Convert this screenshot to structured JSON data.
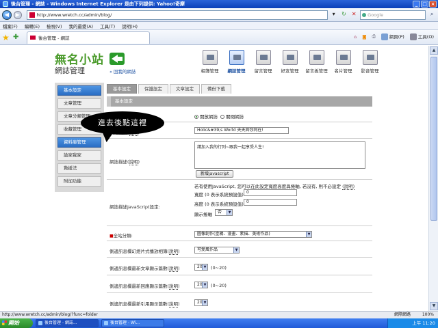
{
  "window": {
    "title": "後台管理 - 網誌 - Windows Internet Explorer 是由下列提供: Yahoo!奇摩"
  },
  "address": {
    "url": "http://www.wretch.cc/admin/blog/",
    "search_placeholder": "Google"
  },
  "menu": [
    "檔案(F)",
    "編輯(E)",
    "檢視(V)",
    "我的最愛(A)",
    "工具(T)",
    "說明(H)"
  ],
  "tab": {
    "label": "後台管理 - 網誌",
    "favicon_text": "YAHOO!"
  },
  "toolbar": {
    "page_label": "網頁(P)",
    "tools_label": "工具(O)"
  },
  "header": {
    "blog_name": "無名小站",
    "subtitle": "網誌管理",
    "back_link": "« 回我的網誌"
  },
  "topnav": [
    {
      "label": "相簿管理",
      "icon": "photo-icon"
    },
    {
      "label": "網誌管理",
      "icon": "blog-icon",
      "active": true
    },
    {
      "label": "留言管理",
      "icon": "message-icon"
    },
    {
      "label": "好友管理",
      "icon": "friends-icon"
    },
    {
      "label": "留言板管理",
      "icon": "guestbook-icon"
    },
    {
      "label": "名片管理",
      "icon": "card-icon"
    },
    {
      "label": "影音管理",
      "icon": "video-icon"
    }
  ],
  "sidebar": {
    "items": [
      "基本設定",
      "文章管理",
      "文章分類管理",
      "收藏管理",
      "資料庫管理",
      "論家我家",
      "救援法",
      "附加功能"
    ]
  },
  "content": {
    "tabs": [
      "基本設定",
      "保護設定",
      "文章設定",
      "備份下載"
    ],
    "section_header": "基本設定",
    "status": {
      "option_open": "開放網誌",
      "option_close": "關閉網誌"
    },
    "title": {
      "label": "網誌名稱",
      "help": "說明",
      "value": "Holic&#39;s World 夫夫與你同在!"
    },
    "description": {
      "label": "網誌描述",
      "help": "說明",
      "value": "請加入我的行列~跟我一起享受人生!",
      "button": "新增javascript"
    },
    "js": {
      "label": "網誌描述JavaScript設定:",
      "note": "若有使用JavaScript, 您可以在此設定寬度高度與捲軸, 若沒有, 則不必設定",
      "note_help": "(說明)",
      "width_label": "寬度 (0 表示系統預設值)",
      "width_value": "0",
      "height_label": "高度 (0 表示系統預設值)",
      "height_value": "0",
      "scroll_label": "顯示捲軸",
      "scroll_value": "否"
    },
    "category": {
      "mark": "■",
      "label": "全站分類:",
      "value": "圖像創作(塗鴉、漫畫、素描、美術作品)"
    },
    "slideshow": {
      "label": "側邊訊息欄幻燈片式播放相簿",
      "help": "說明",
      "value": "可愛風作品"
    },
    "recent_articles": {
      "label": "側邊訊息欄最新文章顯示篇數",
      "help": "說明",
      "value": "20",
      "range": "(0~20)"
    },
    "recent_replies": {
      "label": "側邊訊息欄最新回應顯示篇數",
      "help": "說明",
      "value": "20",
      "range": "(0~20)"
    },
    "recent_trackbacks": {
      "label": "側邊訊息欄最新引用顯示篇數",
      "help": "說明",
      "value": "20"
    }
  },
  "callout": {
    "text": "進去後點這裡"
  },
  "statusbar": {
    "url": "http://www.wretch.cc/admin/blog/?func=folder",
    "zone": "網際網路",
    "zoom": "100%"
  },
  "taskbar": {
    "start": "開始",
    "task1": "後台管理 - 網誌...",
    "task2": "後台管理 - Wi...",
    "clock": "上午 11:20"
  }
}
